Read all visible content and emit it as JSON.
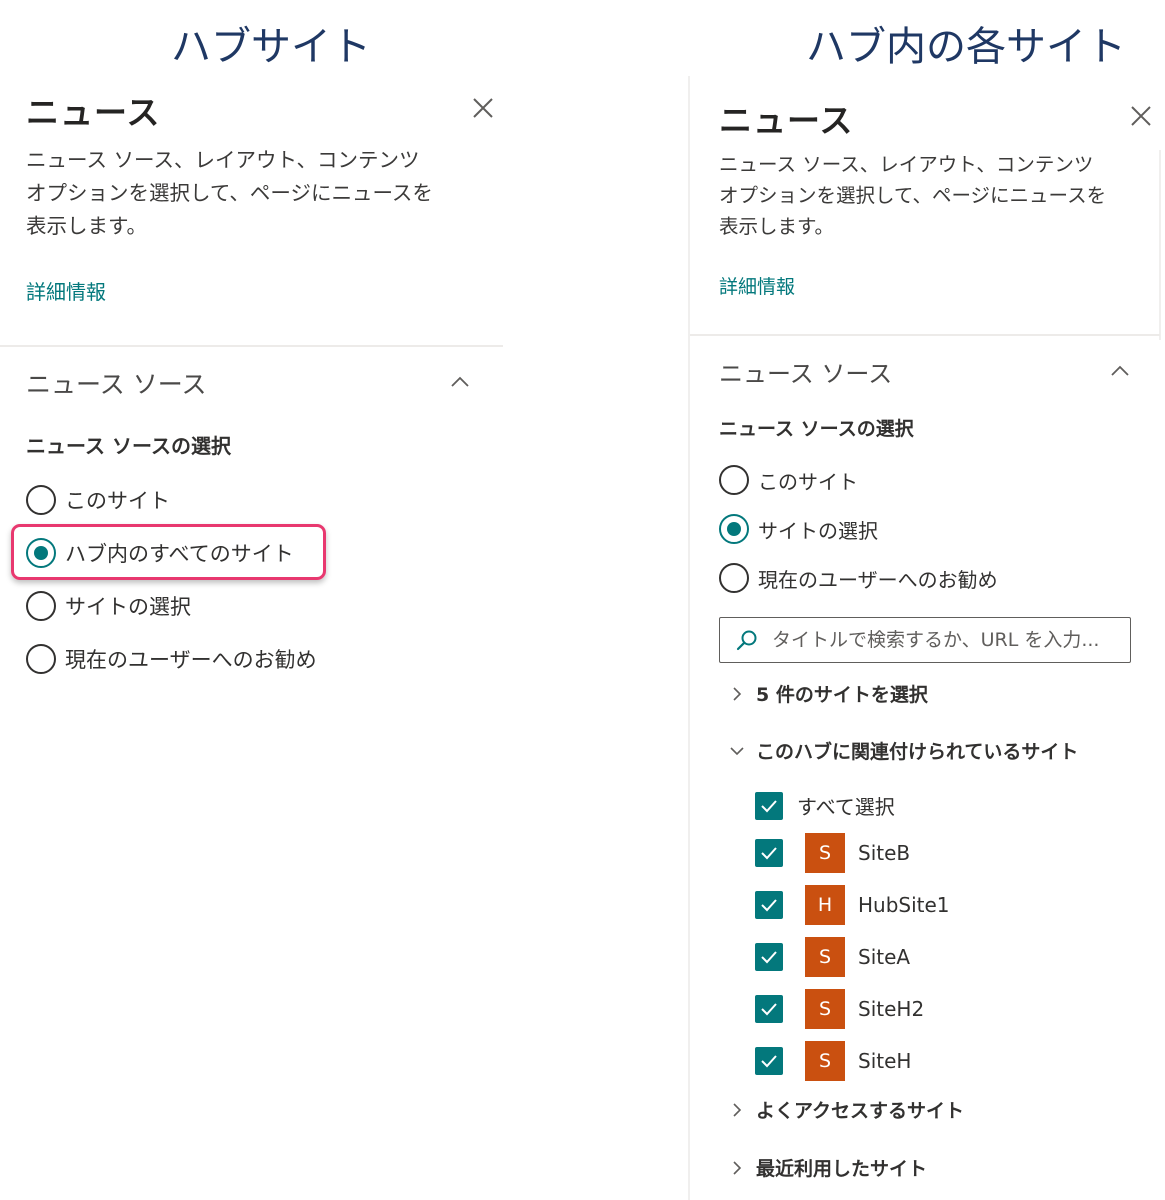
{
  "left": {
    "caption": "ハブサイト",
    "title": "ニュース",
    "description_lines": [
      "ニュース ソース、レイアウト、コンテンツ",
      "オプションを選択して、ページにニュースを",
      "表示します。"
    ],
    "learn_more": "詳細情報",
    "section_title": "ニュース ソース",
    "select_label": "ニュース ソースの選択",
    "options": [
      "このサイト",
      "ハブ内のすべてのサイト",
      "サイトの選択",
      "現在のユーザーへのお勧め"
    ],
    "selected_index": 1
  },
  "right": {
    "caption": "ハブ内の各サイト",
    "title": "ニュース",
    "description_lines": [
      "ニュース ソース、レイアウト、コンテンツ",
      "オプションを選択して、ページにニュースを",
      "表示します。"
    ],
    "learn_more": "詳細情報",
    "section_title": "ニュース ソース",
    "select_label": "ニュース ソースの選択",
    "options": [
      "このサイト",
      "サイトの選択",
      "現在のユーザーへのお勧め"
    ],
    "selected_index": 1,
    "search_placeholder": "タイトルで検索するか、URL を入力...",
    "groups": {
      "selected": "5 件のサイトを選択",
      "hub": "このハブに関連付けられているサイト",
      "frequent": "よくアクセスするサイト",
      "recent": "最近利用したサイト"
    },
    "select_all": "すべて選択",
    "sites": [
      {
        "initial": "S",
        "name": "SiteB"
      },
      {
        "initial": "H",
        "name": "HubSite1"
      },
      {
        "initial": "S",
        "name": "SiteA"
      },
      {
        "initial": "S",
        "name": "SiteH2"
      },
      {
        "initial": "S",
        "name": "SiteH"
      }
    ]
  },
  "colors": {
    "accent": "#03787c",
    "site_tile": "#ca5010",
    "highlight": "#e8386f",
    "caption": "#1f3864"
  }
}
